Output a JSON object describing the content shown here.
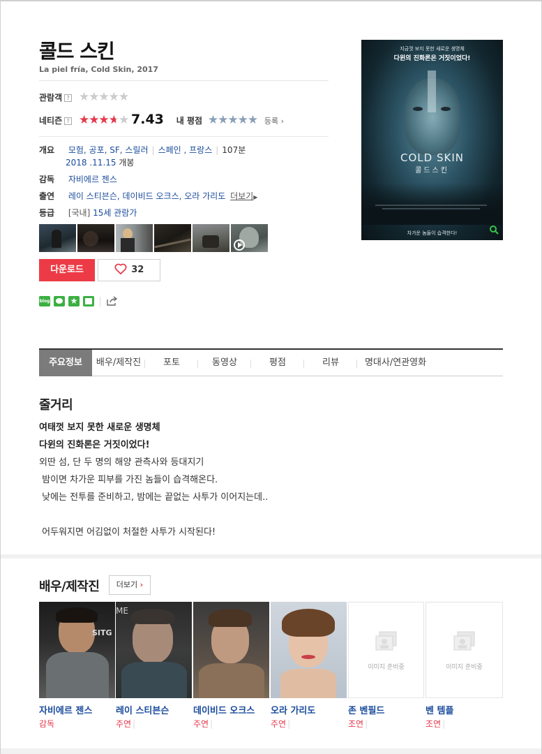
{
  "movie": {
    "title": "콜드 스킨",
    "subtitle": "La piel fría, Cold Skin, 2017"
  },
  "ratings": {
    "audience_label": "관람객",
    "audience_help": "?",
    "audience_stars": 0,
    "netizen_label": "네티즌",
    "netizen_help": "?",
    "netizen_stars": 3.7,
    "netizen_score": "7.43",
    "my_rating_label": "내 평점",
    "register_label": "등록"
  },
  "info": {
    "overview_label": "개요",
    "genres": "모험, 공포, SF, 스릴러",
    "countries": "스페인 , 프랑스",
    "runtime": "107분",
    "release_date": "2018 .11.15",
    "release_suffix": "개봉",
    "director_label": "감독",
    "director": "자비에르 젠스",
    "cast_label": "출연",
    "cast": "레이 스티븐슨, 데이비드 오크스, 오라 가리도",
    "cast_more": "더보기",
    "grade_label": "등급",
    "grade_prefix": "[국내]",
    "grade": "15세 관람가"
  },
  "actions": {
    "download_label": "다운로드",
    "like_count": "32",
    "share_icons": [
      "blog-icon",
      "line-icon",
      "star-icon",
      "band-icon"
    ]
  },
  "poster": {
    "tagline_1": "지금껏 보지 못한 새로운 생명체",
    "tagline_2": "다윈의 진화론은 거짓이었다!",
    "title_en": "COLD SKIN",
    "title_ko": "콜드스킨",
    "bottom_text": "차가운 놈들이 습격한다!"
  },
  "tabs": [
    "주요정보",
    "배우/제작진",
    "포토",
    "동영상",
    "평점",
    "리뷰",
    "명대사/연관영화"
  ],
  "synopsis": {
    "heading": "줄거리",
    "bold_line_1": "여태껏 보지 못한 새로운 생명체",
    "bold_line_2": "다윈의 진화론은 거짓이었다!",
    "line_1": "외딴 섬, 단 두 명의 해양 관측사와 등대지기",
    "line_2": " 밤이면 차가운 피부를 가진 놈들이 습격해온다.",
    "line_3": " 낮에는 전투를 준비하고, 밤에는 끝없는 사투가 이어지는데..",
    "line_4": " 어두워지면 어김없이 처절한 사투가 시작된다!"
  },
  "cast_section": {
    "heading": "배우/제작진",
    "more_label": "더보기",
    "no_image_text": "이미지 준비중",
    "people": [
      {
        "name": "자비에르 젠스",
        "role": "감독"
      },
      {
        "name": "레이 스티븐슨",
        "role": "주연"
      },
      {
        "name": "데이비드 오크스",
        "role": "주연"
      },
      {
        "name": "오라 가리도",
        "role": "주연"
      },
      {
        "name": "존 벤필드",
        "role": "조연"
      },
      {
        "name": "벤 템플",
        "role": "조연"
      }
    ]
  },
  "colors": {
    "accent_red": "#ec3b46",
    "link_blue": "#1a4b9c",
    "tab_active": "#7b7b7b"
  }
}
